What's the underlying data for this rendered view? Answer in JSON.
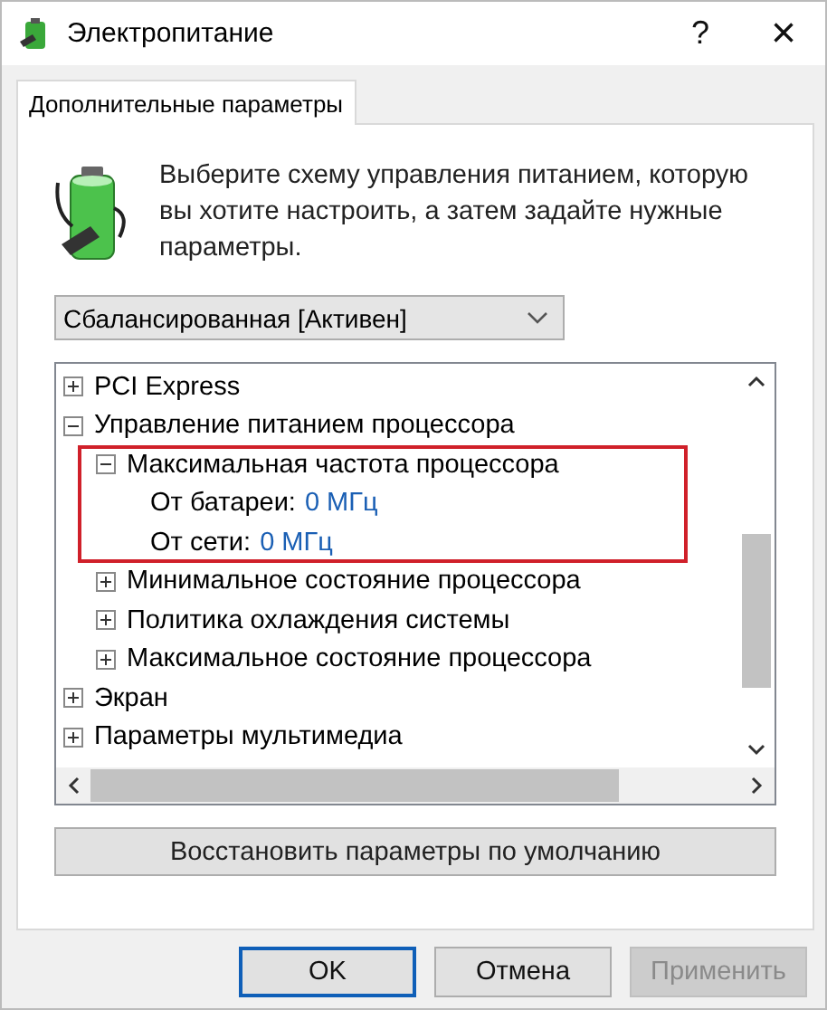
{
  "window": {
    "title": "Электропитание",
    "help": "?",
    "close": "×"
  },
  "tabs": [
    {
      "label": "Дополнительные параметры",
      "selected": true
    }
  ],
  "intro": "Выберите схему управления питанием, которую вы хотите настроить, а затем задайте нужные параметры.",
  "plan_select": {
    "value": "Сбалансированная [Активен]"
  },
  "tree": [
    {
      "kind": "group",
      "label": "PCI Express",
      "expanded": false
    },
    {
      "kind": "group",
      "label": "Управление питанием процессора",
      "expanded": true,
      "children": [
        {
          "kind": "group",
          "label": "Максимальная частота процессора",
          "expanded": true,
          "highlighted": true,
          "children": [
            {
              "kind": "setting",
              "label": "От батареи:",
              "value": "0 МГц"
            },
            {
              "kind": "setting",
              "label": "От сети:",
              "value": "0 МГц"
            }
          ]
        },
        {
          "kind": "group",
          "label": "Минимальное состояние процессора",
          "expanded": false,
          "highlighted": false
        },
        {
          "kind": "group",
          "label": "Политика охлаждения системы",
          "expanded": false,
          "highlighted": false
        },
        {
          "kind": "group",
          "label": "Максимальное состояние процессора",
          "expanded": false,
          "highlighted": false
        }
      ]
    },
    {
      "kind": "group",
      "label": "Экран",
      "expanded": false
    },
    {
      "kind": "group",
      "label": "Параметры мультимедиа",
      "expanded": false
    }
  ],
  "restore_button": "Восстановить параметры по умолчанию",
  "buttons": [
    {
      "label": "OK",
      "default": true,
      "disabled": false
    },
    {
      "label": "Отмена",
      "default": false,
      "disabled": false
    },
    {
      "label": "Применить",
      "default": false,
      "disabled": true
    }
  ]
}
